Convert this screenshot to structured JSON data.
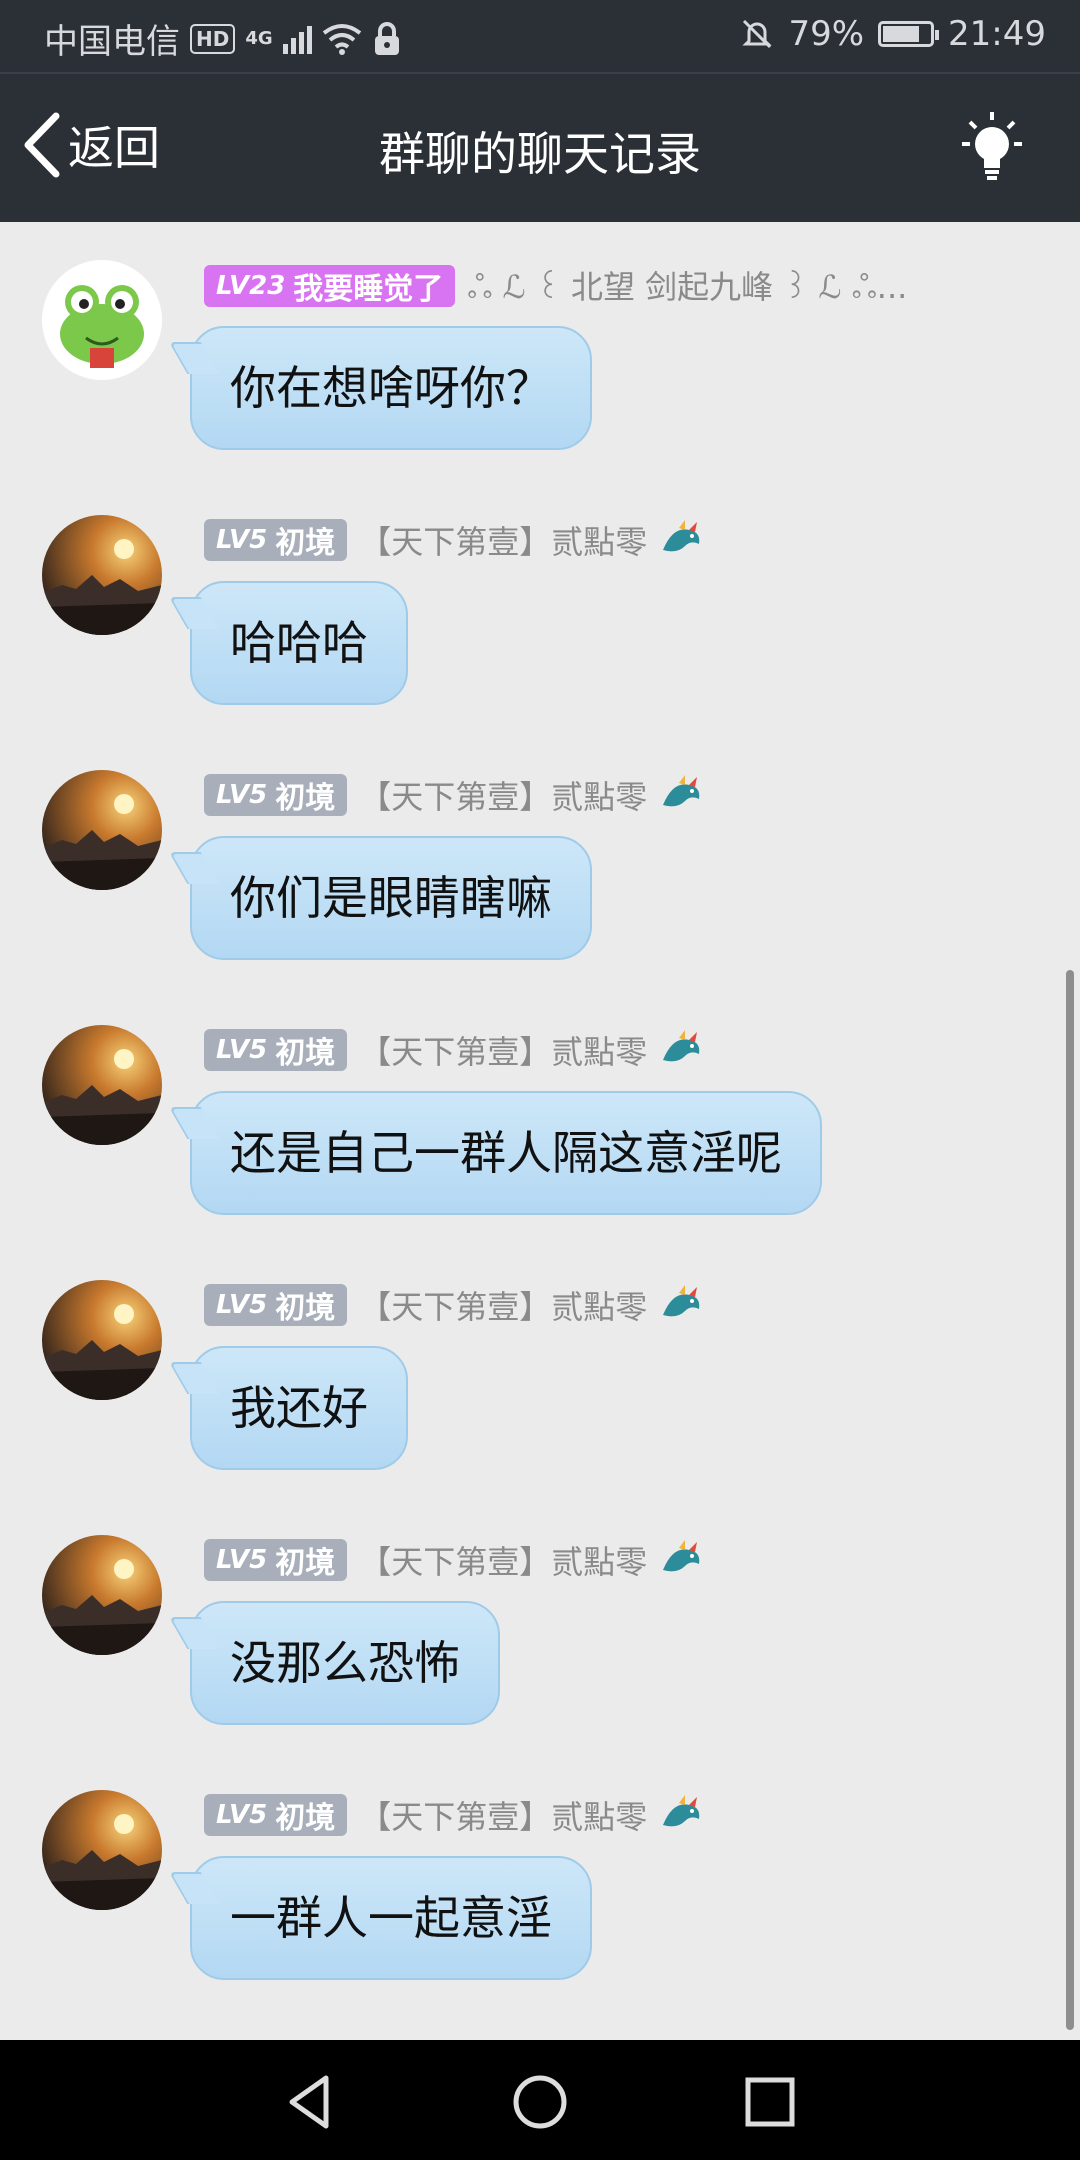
{
  "status_bar": {
    "carrier": "中国电信",
    "hd": "HD",
    "network": "4G",
    "battery": "79%",
    "battery_level": 0.79,
    "time": "21:49",
    "icons": [
      "hd-icon",
      "signal-icon",
      "wifi-icon",
      "lock-icon",
      "mute-bell-icon",
      "battery-icon"
    ]
  },
  "header": {
    "back_label": "返回",
    "title": "群聊的聊天记录",
    "right_icon": "lightbulb-icon"
  },
  "messages": [
    {
      "level": "LV23",
      "level_title": "我要睡觉了",
      "badge_color": "#d873f2",
      "nickname": "ஃ ℒ ꒰ 北望 剑起九峰 ꒱ ℒ ஃ...",
      "avatar": "frog-avatar",
      "text": "你在想啥呀你？"
    },
    {
      "level": "LV5",
      "level_title": "初境",
      "badge_color": "#a8afba",
      "nickname": "【天下第壹】贰點零",
      "avatar": "sunset-avatar",
      "text": "哈哈哈"
    },
    {
      "level": "LV5",
      "level_title": "初境",
      "badge_color": "#a8afba",
      "nickname": "【天下第壹】贰點零",
      "avatar": "sunset-avatar",
      "text": "你们是眼睛瞎嘛"
    },
    {
      "level": "LV5",
      "level_title": "初境",
      "badge_color": "#a8afba",
      "nickname": "【天下第壹】贰點零",
      "avatar": "sunset-avatar",
      "text": "还是自己一群人隔这意淫呢"
    },
    {
      "level": "LV5",
      "level_title": "初境",
      "badge_color": "#a8afba",
      "nickname": "【天下第壹】贰點零",
      "avatar": "sunset-avatar",
      "text": "我还好"
    },
    {
      "level": "LV5",
      "level_title": "初境",
      "badge_color": "#a8afba",
      "nickname": "【天下第壹】贰點零",
      "avatar": "sunset-avatar",
      "text": "没那么恐怖"
    },
    {
      "level": "LV5",
      "level_title": "初境",
      "badge_color": "#a8afba",
      "nickname": "【天下第壹】贰點零",
      "avatar": "sunset-avatar",
      "text": "一群人一起意淫"
    }
  ],
  "nav_bar": {
    "buttons": [
      "back-triangle-icon",
      "home-circle-icon",
      "recents-square-icon"
    ]
  }
}
